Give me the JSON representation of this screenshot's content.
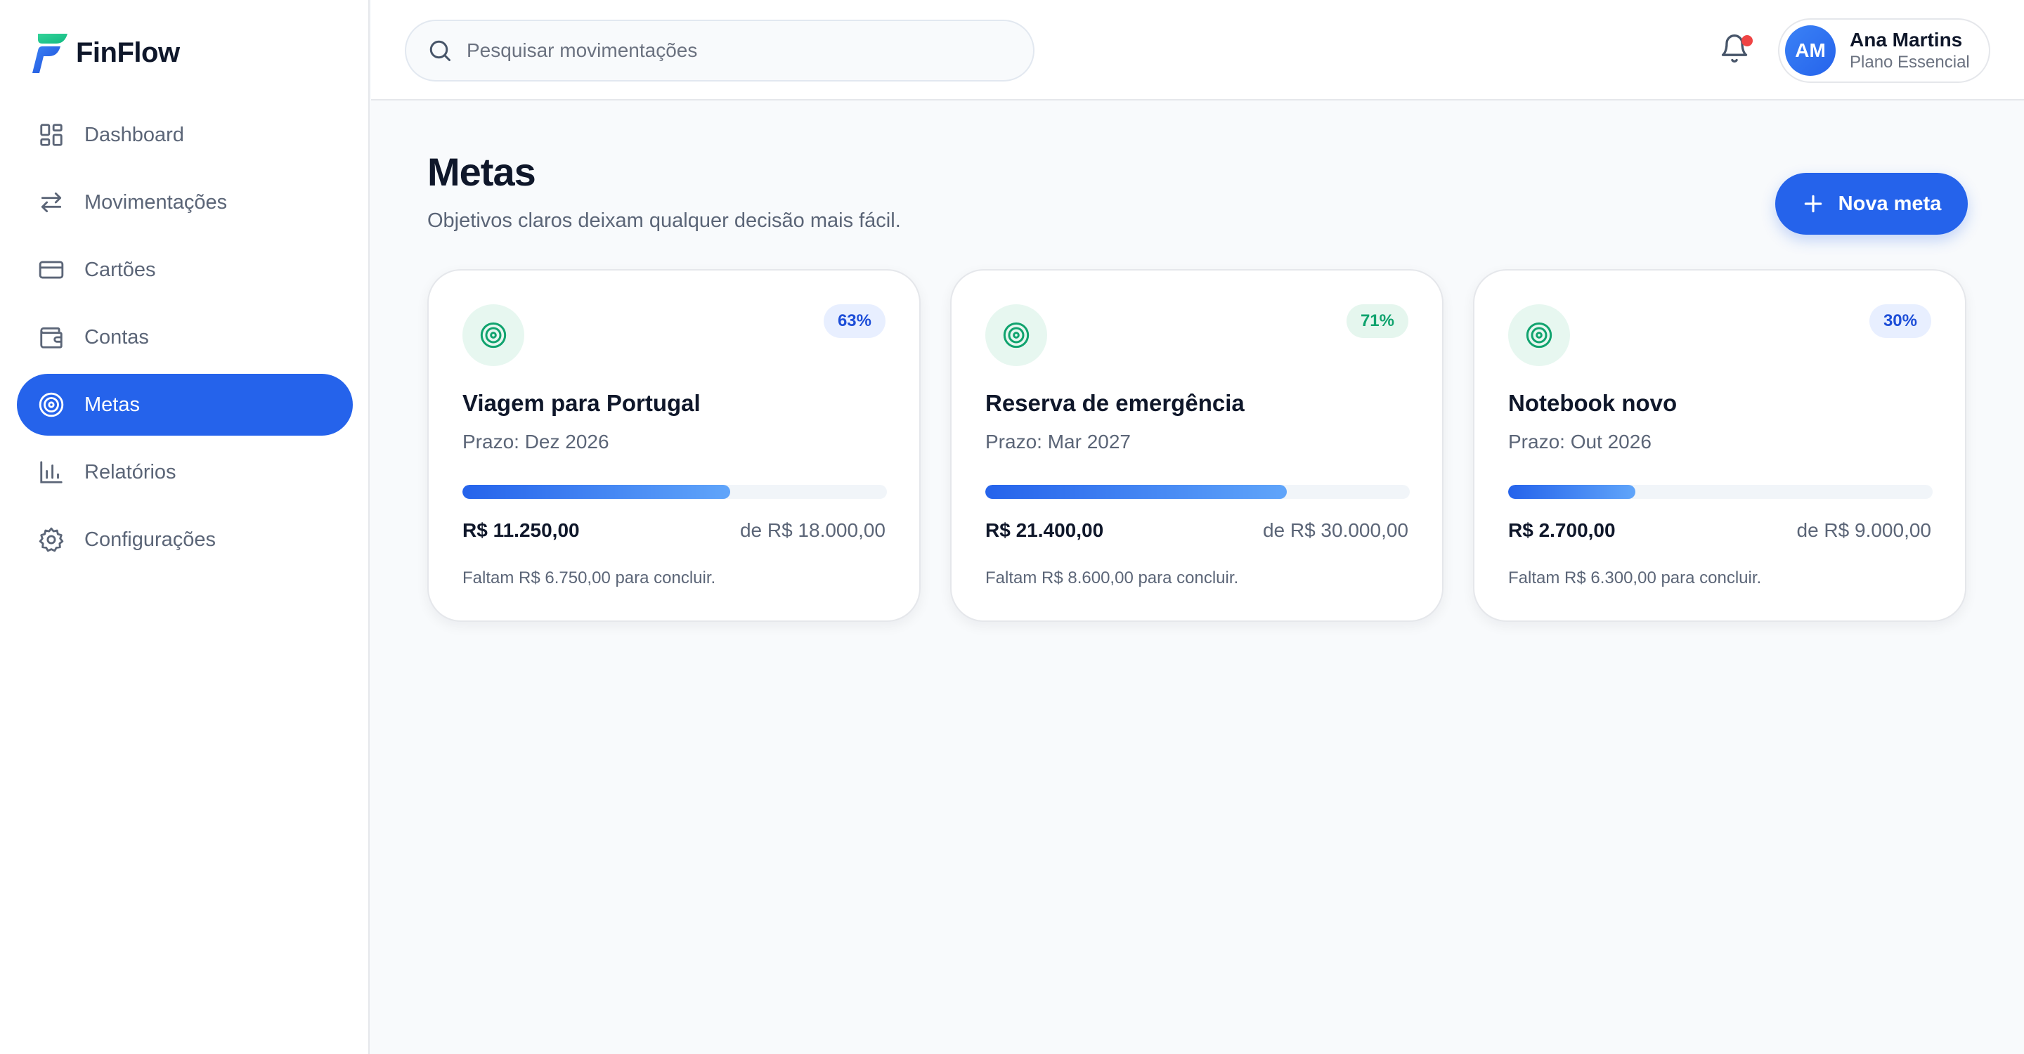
{
  "brand": {
    "name": "FinFlow"
  },
  "sidebar": {
    "items": [
      {
        "label": "Dashboard",
        "icon": "dashboard-icon"
      },
      {
        "label": "Movimentações",
        "icon": "transfer-arrows-icon"
      },
      {
        "label": "Cartões",
        "icon": "credit-card-icon"
      },
      {
        "label": "Contas",
        "icon": "wallet-icon"
      },
      {
        "label": "Metas",
        "icon": "target-icon",
        "active": true
      },
      {
        "label": "Relatórios",
        "icon": "bar-chart-icon"
      },
      {
        "label": "Configurações",
        "icon": "gear-icon"
      }
    ]
  },
  "header": {
    "search": {
      "placeholder": "Pesquisar movimentações",
      "value": ""
    },
    "notifications": {
      "unread": true
    },
    "user": {
      "initials": "AM",
      "name": "Ana Martins",
      "plan": "Plano Essencial"
    }
  },
  "page": {
    "title": "Metas",
    "subtitle": "Objetivos claros deixam qualquer decisão mais fácil.",
    "new_button_label": "Nova meta"
  },
  "goals": [
    {
      "title": "Viagem para Portugal",
      "deadline": "Prazo: Dez 2026",
      "percent_label": "63%",
      "progress": 0.63,
      "badge_color": "blue",
      "current": "R$ 11.250,00",
      "target": "de R$ 18.000,00",
      "remaining": "Faltam R$ 6.750,00 para concluir."
    },
    {
      "title": "Reserva de emergência",
      "deadline": "Prazo: Mar 2027",
      "percent_label": "71%",
      "progress": 0.71,
      "badge_color": "green",
      "current": "R$ 21.400,00",
      "target": "de R$ 30.000,00",
      "remaining": "Faltam R$ 8.600,00 para concluir."
    },
    {
      "title": "Notebook novo",
      "deadline": "Prazo: Out 2026",
      "percent_label": "30%",
      "progress": 0.3,
      "badge_color": "blue",
      "current": "R$ 2.700,00",
      "target": "de R$ 9.000,00",
      "remaining": "Faltam R$ 6.300,00 para concluir."
    }
  ],
  "colors": {
    "primary": "#2563eb",
    "accent_green": "#10a36e",
    "notification": "#ef4444"
  }
}
